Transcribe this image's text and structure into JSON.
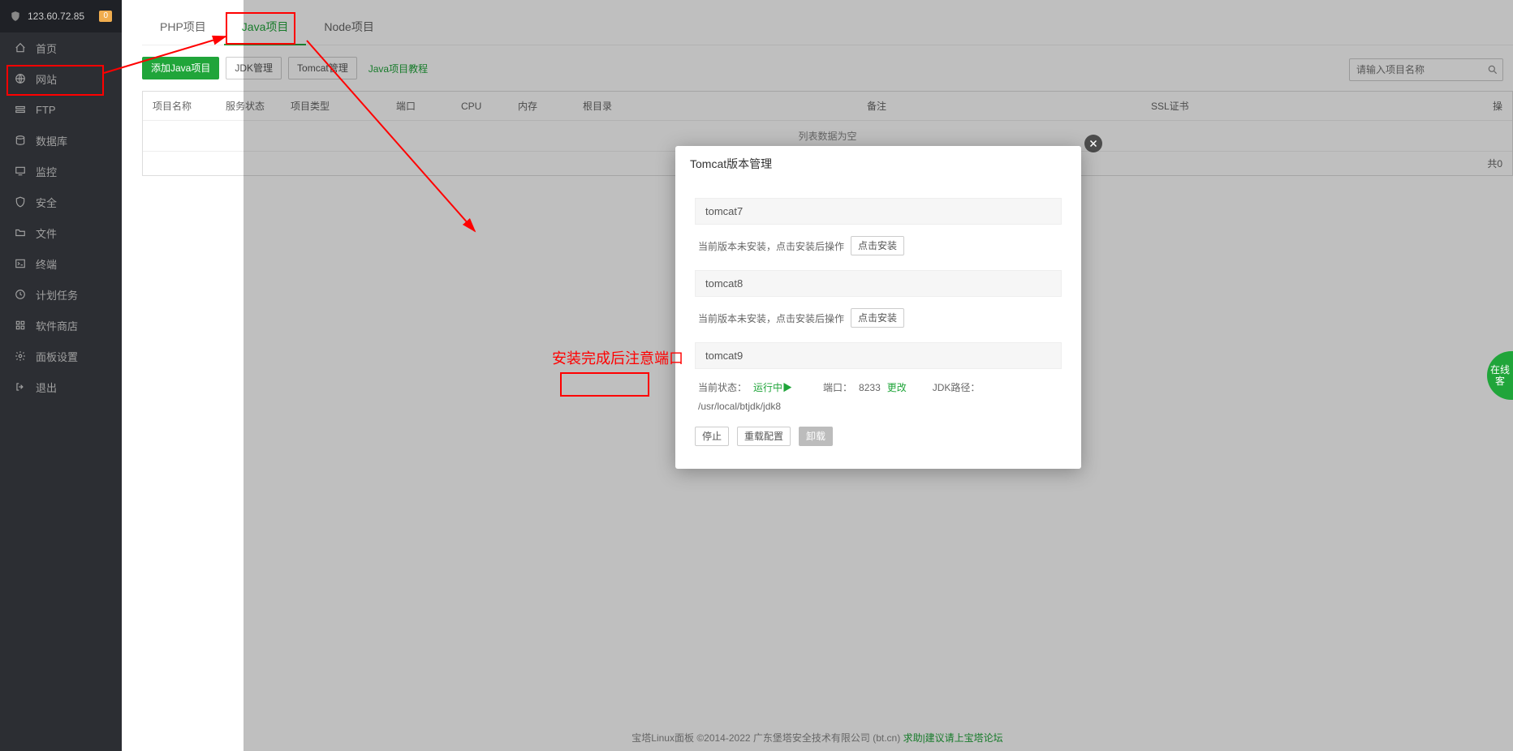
{
  "header": {
    "ip": "123.60.72.85",
    "badge": "0"
  },
  "sidebar": {
    "items": [
      {
        "label": "首页",
        "icon": "home"
      },
      {
        "label": "网站",
        "icon": "globe"
      },
      {
        "label": "FTP",
        "icon": "ftp"
      },
      {
        "label": "数据库",
        "icon": "db"
      },
      {
        "label": "监控",
        "icon": "monitor"
      },
      {
        "label": "安全",
        "icon": "shield"
      },
      {
        "label": "文件",
        "icon": "folder"
      },
      {
        "label": "终端",
        "icon": "terminal"
      },
      {
        "label": "计划任务",
        "icon": "clock"
      },
      {
        "label": "软件商店",
        "icon": "apps"
      },
      {
        "label": "面板设置",
        "icon": "gear"
      },
      {
        "label": "退出",
        "icon": "logout"
      }
    ]
  },
  "tabs": {
    "items": [
      "PHP项目",
      "Java项目",
      "Node项目"
    ],
    "active": 1
  },
  "toolbar": {
    "add": "添加Java项目",
    "jdk": "JDK管理",
    "tomcat": "Tomcat管理",
    "tutorial": "Java项目教程"
  },
  "search": {
    "placeholder": "请输入项目名称"
  },
  "table": {
    "headers": [
      "项目名称",
      "服务状态",
      "项目类型",
      "端口",
      "CPU",
      "内存",
      "根目录",
      "备注",
      "SSL证书",
      "操"
    ],
    "empty": "列表数据为空",
    "footer": "共0"
  },
  "footer": {
    "text": "宝塔Linux面板 ©2014-2022 广东堡塔安全技术有限公司 (bt.cn) ",
    "link": "求助|建议请上宝塔论坛"
  },
  "modal": {
    "title": "Tomcat版本管理",
    "versions": [
      {
        "name": "tomcat7",
        "status_text": "当前版本未安装，点击安装后操作",
        "install_btn": "点击安装"
      },
      {
        "name": "tomcat8",
        "status_text": "当前版本未安装，点击安装后操作",
        "install_btn": "点击安装"
      },
      {
        "name": "tomcat9"
      }
    ],
    "tomcat9": {
      "status_label": "当前状态：",
      "status_value": "运行中▶",
      "port_label": "端口：",
      "port_value": "8233",
      "change": "更改",
      "jdk_label": "JDK路径：",
      "jdk_value": "/usr/local/btjdk/jdk8",
      "stop": "停止",
      "reload": "重载配置",
      "uninstall": "卸载"
    }
  },
  "float": "在线客",
  "annotations": {
    "port_hint": "安装完成后注意端口"
  }
}
